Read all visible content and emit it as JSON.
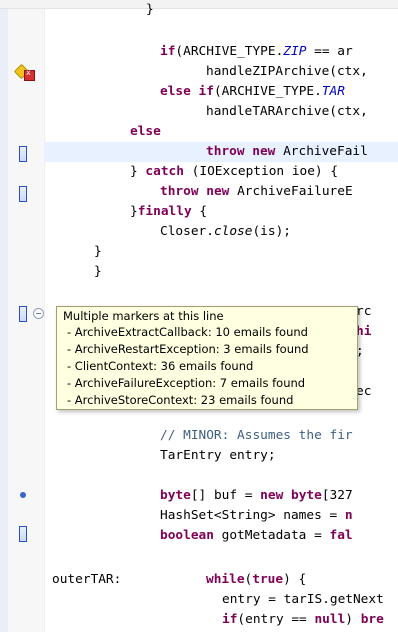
{
  "tooltip": {
    "title": "Multiple markers at this line",
    "items": [
      "- ArchiveExtractCallback: 10 emails found",
      "- ArchiveRestartException: 3 emails found",
      "- ClientContext: 36 emails found",
      "- ArchiveFailureException: 7 emails found",
      "- ArchiveStoreContext: 23 emails found"
    ]
  },
  "code": {
    "closing_brace": "}",
    "l1_kw": "if",
    "l1_a": "(ARCHIVE_TYPE.",
    "l1_fld": "ZIP",
    "l1_b": " == ar",
    "l2": "handleZIPArchive(ctx,",
    "l3_kw1": "else",
    "l3_kw2": "if",
    "l3_a": "(ARCHIVE_TYPE.",
    "l3_fld": "TAR",
    "l4": "handleTARArchive(ctx,",
    "l5_kw": "else",
    "l6_kw1": "throw",
    "l6_kw2": "new",
    "l6_a": " ArchiveFail",
    "l7_a": "} ",
    "l7_kw": "catch",
    "l7_b": " (IOException ioe) {",
    "l8_kw1": "throw",
    "l8_kw2": "new",
    "l8_a": " ArchiveFailureE",
    "l9_a": "}",
    "l9_kw": "finally",
    "l9_b": " {",
    "l10_a": "Closer.",
    "l10_stm": "close",
    "l10_b": "(is);",
    "l11": "}",
    "l12": "}",
    "frag1": "rc",
    "frag2_kw": "hi",
    "frag3": ";",
    "frag4": "ec",
    "comment": "// MINOR: Assumes the fir",
    "l14": "TarEntry entry;",
    "l15_a": "byte",
    "l15_b": "[] buf = ",
    "l15_kw": "new",
    "l15_c": " ",
    "l15_kw2": "byte",
    "l15_d": "[327",
    "l16_a": "HashSet<String> names = ",
    "l16_kw": "n",
    "l17_kw": "boolean",
    "l17_a": " gotMetadata = ",
    "l17_kw2": "fal",
    "label": "outerTAR:",
    "l18_kw": "while",
    "l18_a": "(",
    "l18_kw2": "true",
    "l18_b": ") {",
    "l19": "entry = tarIS.getNext",
    "l20_kw": "if",
    "l20_a": "(entry == ",
    "l20_kw2": "null",
    "l20_b": ") ",
    "l20_kw3": "bre"
  }
}
